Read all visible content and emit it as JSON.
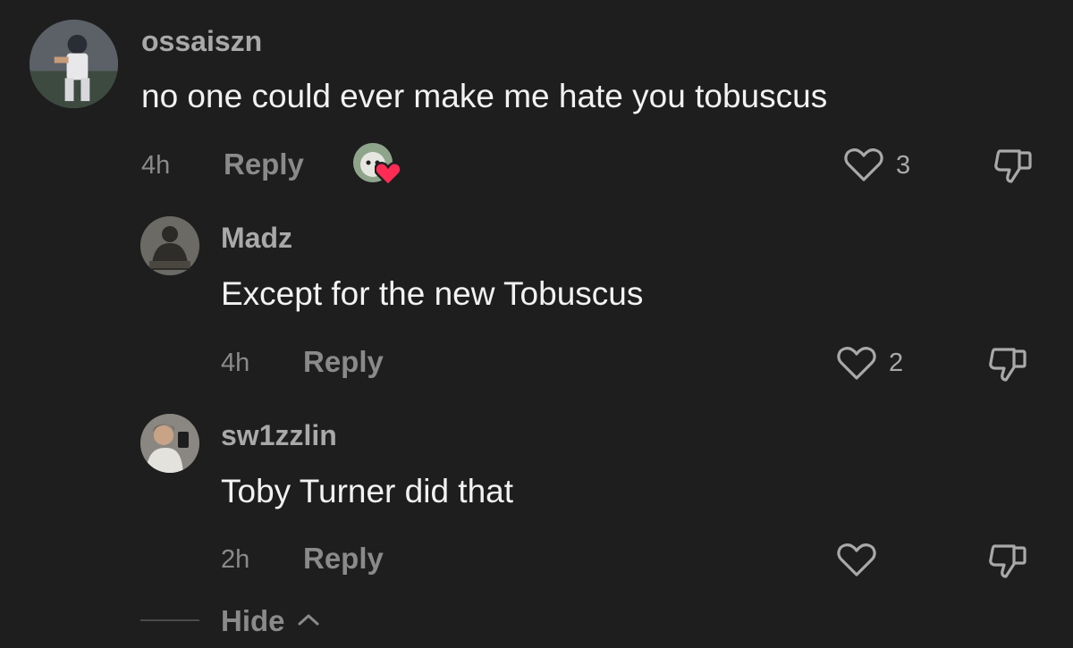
{
  "colors": {
    "background": "#1e1e1e",
    "username": "#a9a9a9",
    "text": "#f2f2f2",
    "muted": "#8a8a8a",
    "creator_heart": "#fe2c55"
  },
  "comments": [
    {
      "username": "ossaiszn",
      "text": "no one could ever make me hate you tobuscus",
      "time": "4h",
      "reply_label": "Reply",
      "like_count": "3",
      "liked_by_creator": true
    },
    {
      "username": "Madz",
      "text": "Except for the new Tobuscus",
      "time": "4h",
      "reply_label": "Reply",
      "like_count": "2"
    },
    {
      "username": "sw1zzlin",
      "text": "Toby Turner did that",
      "time": "2h",
      "reply_label": "Reply",
      "like_count": ""
    }
  ],
  "replies_toggle": {
    "label": "Hide",
    "icon": "chevron-up-icon"
  },
  "icons": {
    "like": "heart-outline-icon",
    "dislike": "thumbs-down-icon",
    "creator_like": "creator-heart-badge"
  }
}
